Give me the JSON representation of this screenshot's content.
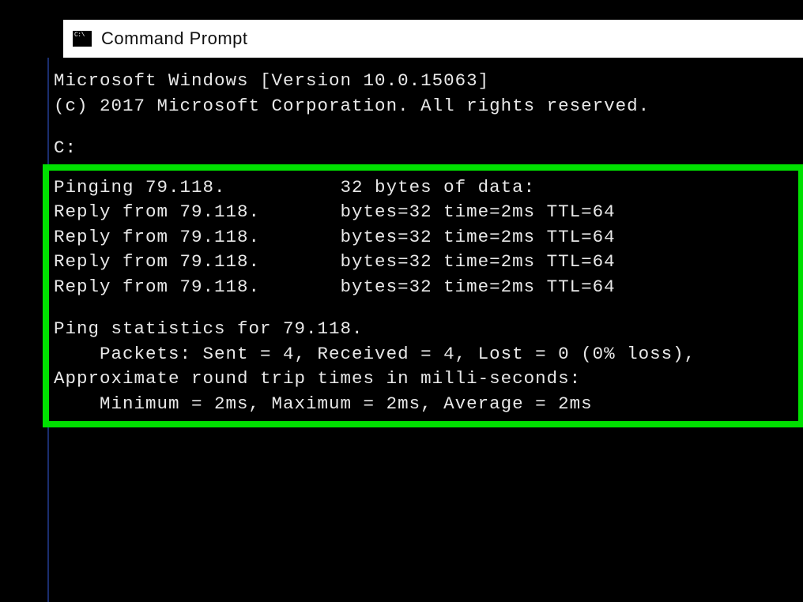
{
  "window": {
    "title": "Command Prompt"
  },
  "header": {
    "line1": "Microsoft Windows [Version 10.0.15063]",
    "line2": "(c) 2017 Microsoft Corporation. All rights reserved."
  },
  "prompt": "C:",
  "ping": {
    "pinging_line": "Pinging 79.118.          32 bytes of data:",
    "replies": [
      "Reply from 79.118.       bytes=32 time=2ms TTL=64",
      "Reply from 79.118.       bytes=32 time=2ms TTL=64",
      "Reply from 79.118.       bytes=32 time=2ms TTL=64",
      "Reply from 79.118.       bytes=32 time=2ms TTL=64"
    ],
    "stats_header": "Ping statistics for 79.118.",
    "packets_line": "    Packets: Sent = 4, Received = 4, Lost = 0 (0% loss),",
    "rtt_header": "Approximate round trip times in milli-seconds:",
    "rtt_line": "    Minimum = 2ms, Maximum = 2ms, Average = 2ms"
  }
}
